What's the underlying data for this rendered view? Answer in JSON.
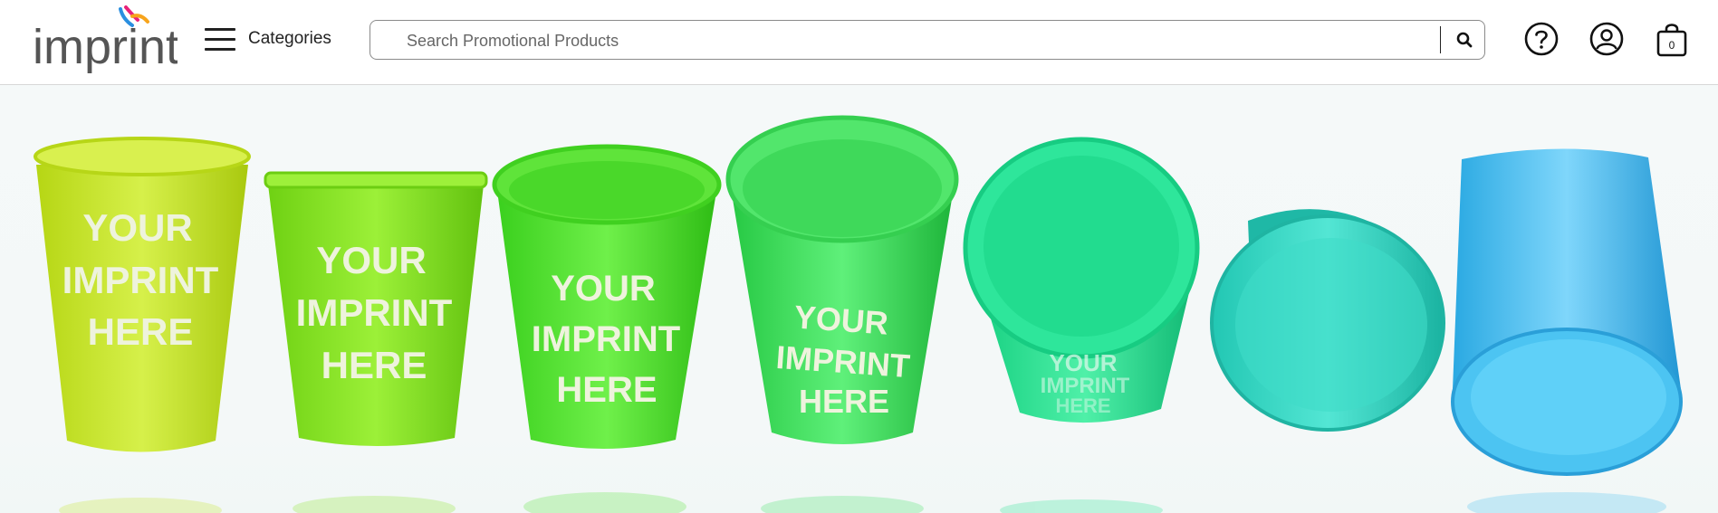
{
  "header": {
    "logo": {
      "text": "imprint",
      "icon": "imprint-logo-icon"
    },
    "categories": {
      "label": "Categories",
      "icon": "hamburger-menu-icon"
    },
    "search": {
      "placeholder": "Search Promotional Products",
      "value": "",
      "icon": "search-icon"
    },
    "help": {
      "icon": "help-question-icon"
    },
    "account": {
      "icon": "user-account-icon"
    },
    "cart": {
      "icon": "shopping-bag-icon",
      "count": "0"
    }
  },
  "hero": {
    "cups": [
      {
        "print": [
          "YOUR",
          "IMPRINT",
          "HERE"
        ],
        "color": "#c4e51c"
      },
      {
        "print": [
          "YOUR",
          "IMPRINT",
          "HERE"
        ],
        "color": "#86e21a"
      },
      {
        "print": [
          "YOUR",
          "IMPRINT",
          "HERE"
        ],
        "color": "#4fe22a"
      },
      {
        "print": [
          "YOUR",
          "IMPRINT",
          "HERE"
        ],
        "color": "#38e05a"
      },
      {
        "print": [
          "YOUR",
          "IMPRINT",
          "HERE"
        ],
        "color": "#1fe28f"
      },
      {
        "print": [],
        "color": "#2fd6c2"
      },
      {
        "print": [],
        "color": "#3fbcee"
      }
    ]
  },
  "colors": {
    "accent_text": "#222222",
    "border": "#8a8a8a",
    "hero_bg": "#f4f8f8",
    "print_text": "#eef3dd"
  }
}
